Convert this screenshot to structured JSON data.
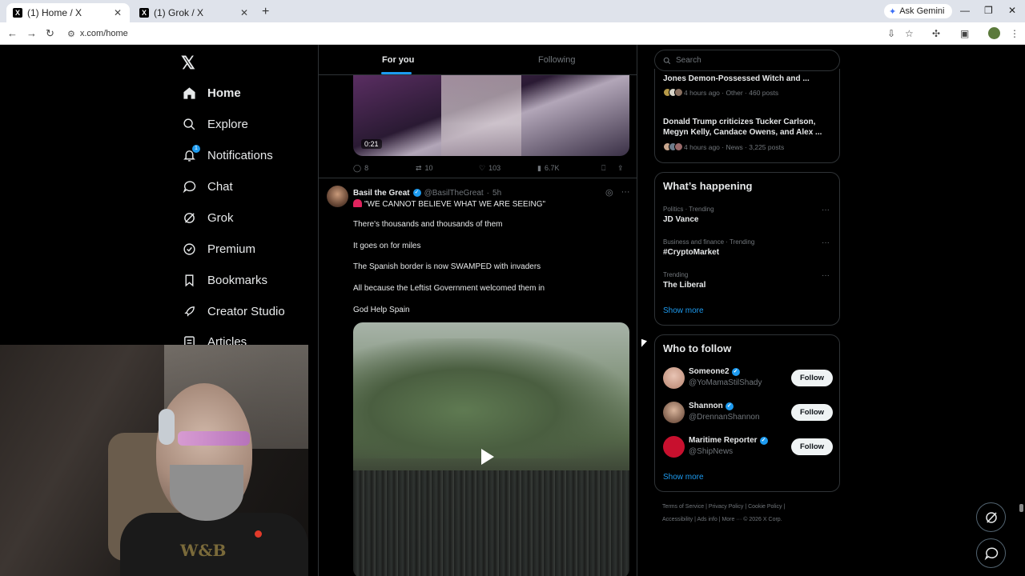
{
  "browser": {
    "tabs": [
      {
        "title": "(1) Home / X",
        "active": true
      },
      {
        "title": "(1) Grok / X",
        "active": false
      }
    ],
    "ask_gemini": "Ask Gemini",
    "url": "x.com/home"
  },
  "nav": {
    "items": [
      {
        "label": "Home",
        "icon": "home-icon"
      },
      {
        "label": "Explore",
        "icon": "search-icon"
      },
      {
        "label": "Notifications",
        "icon": "bell-icon",
        "badge": "1"
      },
      {
        "label": "Chat",
        "icon": "chat-icon"
      },
      {
        "label": "Grok",
        "icon": "grok-icon"
      },
      {
        "label": "Premium",
        "icon": "premium-icon"
      },
      {
        "label": "Bookmarks",
        "icon": "bookmark-icon"
      },
      {
        "label": "Creator Studio",
        "icon": "rocket-icon"
      },
      {
        "label": "Articles",
        "icon": "articles-icon"
      }
    ]
  },
  "feed": {
    "tabs": {
      "for_you": "For you",
      "following": "Following"
    },
    "prev_post": {
      "video_duration": "0:21",
      "replies": "8",
      "reposts": "10",
      "likes": "103",
      "views": "6.7K"
    },
    "post": {
      "name": "Basil the Great",
      "handle": "@BasilTheGreat",
      "time": "5h",
      "lines": [
        "\"WE CANNOT BELIEVE WHAT WE ARE SEEING\"",
        "There's thousands and thousands of them",
        "It goes on for miles",
        "The Spanish border is now SWAMPED with invaders",
        "All because the Leftist Government welcomed them in",
        "God Help Spain"
      ]
    }
  },
  "sidebar": {
    "search_placeholder": "Search",
    "news": [
      {
        "title": "Jones Demon-Possessed Witch and ...",
        "meta": "4 hours ago · Other · 460 posts"
      },
      {
        "title": "Donald Trump criticizes Tucker Carlson, Megyn Kelly, Candace Owens, and Alex ...",
        "meta": "4 hours ago · News · 3,225 posts"
      }
    ],
    "happening": {
      "title": "What’s happening",
      "trends": [
        {
          "context": "Politics · Trending",
          "name": "JD Vance"
        },
        {
          "context": "Business and finance · Trending",
          "name": "#CryptoMarket"
        },
        {
          "context": "Trending",
          "name": "The Liberal"
        }
      ],
      "show_more": "Show more"
    },
    "who_to_follow": {
      "title": "Who to follow",
      "accounts": [
        {
          "name": "Someone2",
          "handle": "@YoMamaStilShady",
          "button": "Follow"
        },
        {
          "name": "Shannon",
          "handle": "@DrennanShannon",
          "button": "Follow"
        },
        {
          "name": "Maritime Reporter",
          "handle": "@ShipNews",
          "button": "Follow"
        }
      ],
      "show_more": "Show more"
    },
    "footer": {
      "line1": "Terms of Service  |  Privacy Policy  |  Cookie Policy  |",
      "line2": "Accessibility  |  Ads info  |  More ···  © 2026 X Corp."
    }
  },
  "webcam": {
    "shirt_text": "W&B"
  }
}
